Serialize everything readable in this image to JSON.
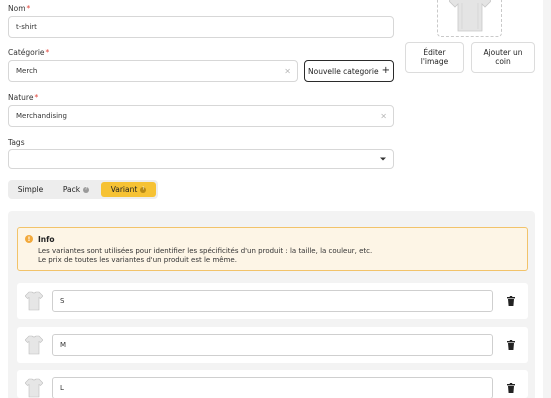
{
  "form": {
    "nom": {
      "label": "Nom",
      "required": "*",
      "value": "t-shirt"
    },
    "categorie": {
      "label": "Catégorie",
      "required": "*",
      "value": "Merch",
      "clear_icon": "×",
      "new_button": "Nouvelle categorie",
      "plus_icon": "+"
    },
    "nature": {
      "label": "Nature",
      "required": "*",
      "value": "Merchandising",
      "clear_icon": "×"
    },
    "tags": {
      "label": "Tags",
      "value": ""
    }
  },
  "image": {
    "edit_button": "Éditer l'image",
    "corner_button": "Ajouter un coin"
  },
  "product_type": {
    "options": [
      {
        "label": "Simple",
        "help": ""
      },
      {
        "label": "Pack",
        "help": "?"
      },
      {
        "label": "Variant",
        "help": "?"
      }
    ],
    "selected": "Variant",
    "accent": "#f6c234"
  },
  "info": {
    "icon": "!",
    "title": "Info",
    "line1": "Les variantes sont utilisées pour identifier les spécificités d'un produit : la taille, la couleur, etc.",
    "line2": "Le prix de toutes les variantes d'un produit est le même."
  },
  "variants": [
    {
      "value": "S"
    },
    {
      "value": "M"
    },
    {
      "value": "L"
    }
  ]
}
